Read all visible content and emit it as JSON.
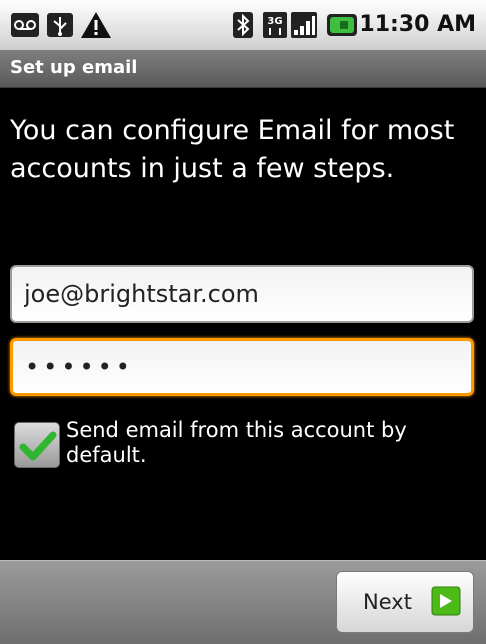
{
  "status_bar": {
    "icons": [
      "voicemail-icon",
      "usb-icon",
      "warning-icon",
      "bluetooth-icon",
      "3g-icon",
      "signal-icon",
      "battery-icon"
    ],
    "time": "11:30 AM"
  },
  "title_bar": {
    "title": "Set up email"
  },
  "intro_text": "You can configure Email for most accounts in just a few steps.",
  "form": {
    "email_value": "joe@brightstar.com",
    "password_value": "••••••",
    "default_account_checked": true,
    "default_account_label": "Send email from this account by default."
  },
  "footer": {
    "next_label": "Next"
  },
  "colors": {
    "focus_border": "#ff9900",
    "check_green": "#2fb52f",
    "next_arrow_green": "#4cbb17"
  }
}
